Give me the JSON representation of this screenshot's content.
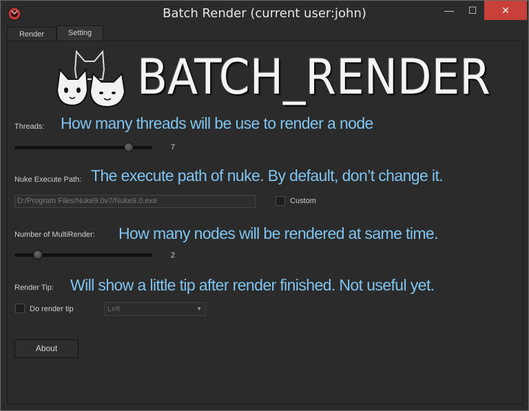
{
  "window": {
    "title": "Batch Render (current user:john)",
    "controls": {
      "minimize": "—",
      "maximize": "☐",
      "close": "✕"
    }
  },
  "tabs": [
    {
      "label": "Render",
      "active": false
    },
    {
      "label": "Setting",
      "active": true
    }
  ],
  "logo": {
    "text": "BATCH_RENDER",
    "icon": "three-cats-icon"
  },
  "threads": {
    "label": "Threads:",
    "note": "How many threads will be use to render a node",
    "value": "7",
    "fraction": 0.83
  },
  "nuke_path": {
    "label": "Nuke Execute Path:",
    "note": "The execute path of nuke. By default, don’t change it.",
    "value": "D:/Program Files/Nuke9.0v7/Nuke9.0.exe",
    "custom_label": "Custom",
    "custom_checked": false
  },
  "multi_render": {
    "label": "Number of MultiRender:",
    "note": "How many nodes will be rendered at same time.",
    "value": "2",
    "fraction": 0.17
  },
  "render_tip": {
    "label": "Render Tip:",
    "note": "Will show a little tip after render finished. Not useful yet.",
    "checkbox_label": "Do render tip",
    "checked": false,
    "position_value": "Left"
  },
  "about_label": "About",
  "colors": {
    "accent_note": "#80c4f0",
    "close_button": "#c9403a",
    "background": "#2b2b2b"
  }
}
